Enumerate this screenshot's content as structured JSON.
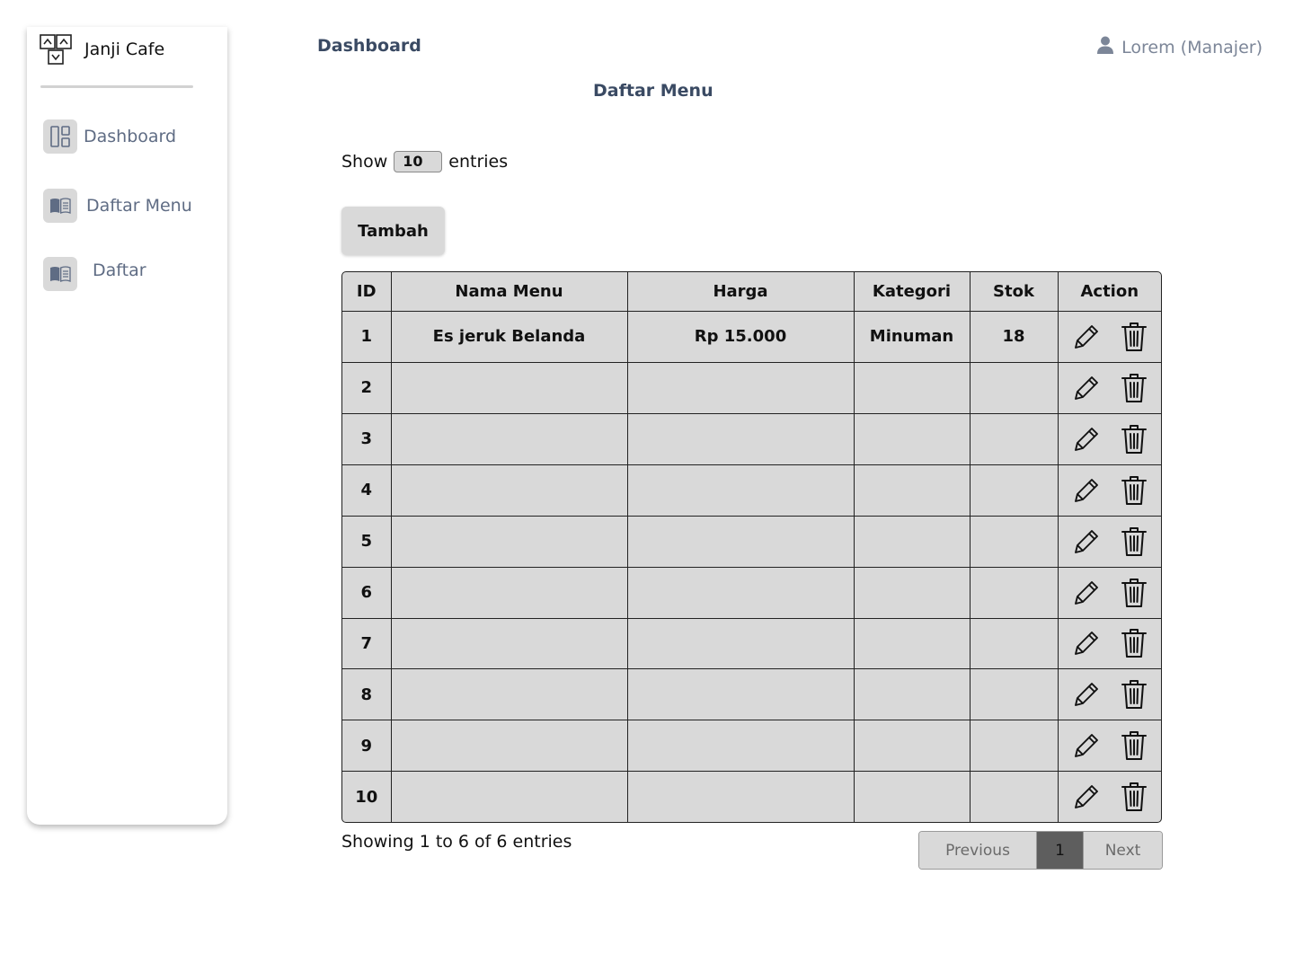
{
  "sidebar": {
    "brand": "Janji Cafe",
    "items": [
      {
        "label": "Dashboard"
      },
      {
        "label": "Daftar Menu"
      },
      {
        "label": "Daftar"
      }
    ]
  },
  "header": {
    "title": "Dashboard",
    "user": "Lorem (Manajer)"
  },
  "page": {
    "title": "Daftar Menu"
  },
  "controls": {
    "show_label": "Show",
    "entries_value": "10",
    "entries_label": "entries",
    "add_label": "Tambah"
  },
  "table": {
    "columns": [
      "ID",
      "Nama Menu",
      "Harga",
      "Kategori",
      "Stok",
      "Action"
    ],
    "rows": [
      {
        "id": "1",
        "nama": "Es jeruk Belanda",
        "harga": "Rp 15.000",
        "kategori": "Minuman",
        "stok": "18"
      },
      {
        "id": "2",
        "nama": "",
        "harga": "",
        "kategori": "",
        "stok": ""
      },
      {
        "id": "3",
        "nama": "",
        "harga": "",
        "kategori": "",
        "stok": ""
      },
      {
        "id": "4",
        "nama": "",
        "harga": "",
        "kategori": "",
        "stok": ""
      },
      {
        "id": "5",
        "nama": "",
        "harga": "",
        "kategori": "",
        "stok": ""
      },
      {
        "id": "6",
        "nama": "",
        "harga": "",
        "kategori": "",
        "stok": ""
      },
      {
        "id": "7",
        "nama": "",
        "harga": "",
        "kategori": "",
        "stok": ""
      },
      {
        "id": "8",
        "nama": "",
        "harga": "",
        "kategori": "",
        "stok": ""
      },
      {
        "id": "9",
        "nama": "",
        "harga": "",
        "kategori": "",
        "stok": ""
      },
      {
        "id": "10",
        "nama": "",
        "harga": "",
        "kategori": "",
        "stok": ""
      }
    ]
  },
  "footer": {
    "showing": "Showing 1 to 6 of 6 entries",
    "prev": "Previous",
    "page": "1",
    "next": "Next"
  },
  "icons": {
    "brand": "cafe-logo-icon",
    "dashboard": "dashboard-grid-icon",
    "menu": "open-book-icon",
    "user": "user-icon",
    "edit": "pencil-icon",
    "delete": "trash-icon"
  },
  "colors": {
    "accent_text": "#3a4a63",
    "muted_text": "#5f6c84",
    "surface": "#d9d9d9",
    "active_page": "#5e5e5e"
  }
}
